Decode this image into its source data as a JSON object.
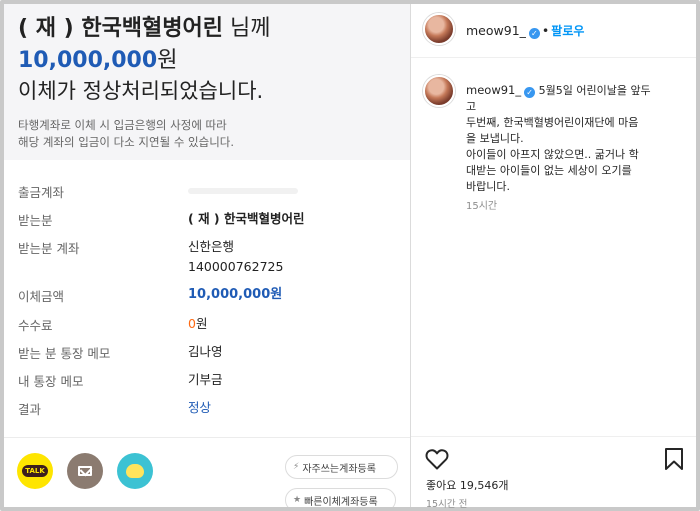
{
  "transfer": {
    "recipient_name": "( 재 ) 한국백혈병어린",
    "recipient_suffix": " 님께",
    "amount_number": "10,000,000",
    "amount_unit": "원",
    "complete_message": "이체가 정상처리되었습니다.",
    "notice_line1": "타행계좌로 이체 시 입금은행의 사정에 따라",
    "notice_line2": "해당 계좌의 입금이 다소 지연될 수 있습니다.",
    "rows": [
      {
        "label": "출금계좌",
        "value": ""
      },
      {
        "label": "받는분",
        "value": "( 재 ) 한국백혈병어린"
      },
      {
        "label": "받는분 계좌",
        "value": "신한은행",
        "value2": "140000762725"
      },
      {
        "label": "이체금액",
        "value": "10,000,000원"
      },
      {
        "label": "수수료",
        "value": "0",
        "value_unit": "원"
      },
      {
        "label": "받는 분 통장 메모",
        "value": "김나영"
      },
      {
        "label": "내 통장 메모",
        "value": "기부금"
      },
      {
        "label": "결과",
        "value": "정상"
      }
    ],
    "share_icons": [
      "kakaotalk-icon",
      "mail-icon",
      "friend-icon"
    ],
    "buttons": {
      "favorite": "자주쓰는계좌등록",
      "quick": "빠른이체계좌등록"
    }
  },
  "instagram": {
    "username": "meow91_",
    "follow_label": "팔로우",
    "caption_lines": [
      "5월5일 어린이날을 앞두",
      "고",
      "두번째, 한국백혈병어린이재단에 마음",
      "을 보냅니다.",
      "아이들이 아프지 않았으면.. 굶거나 학",
      "대받는 아이들이 없는 세상이 오기를",
      "바랍니다."
    ],
    "caption_time": "15시간",
    "likes_label": "좋아요",
    "likes_count": "19,546개",
    "post_time": "15시간 전"
  },
  "colors": {
    "accent_blue": "#1f5bb5",
    "fee_orange": "#ff6a13",
    "instagram_blue": "#0095f6",
    "kakao_yellow": "#fee500"
  }
}
